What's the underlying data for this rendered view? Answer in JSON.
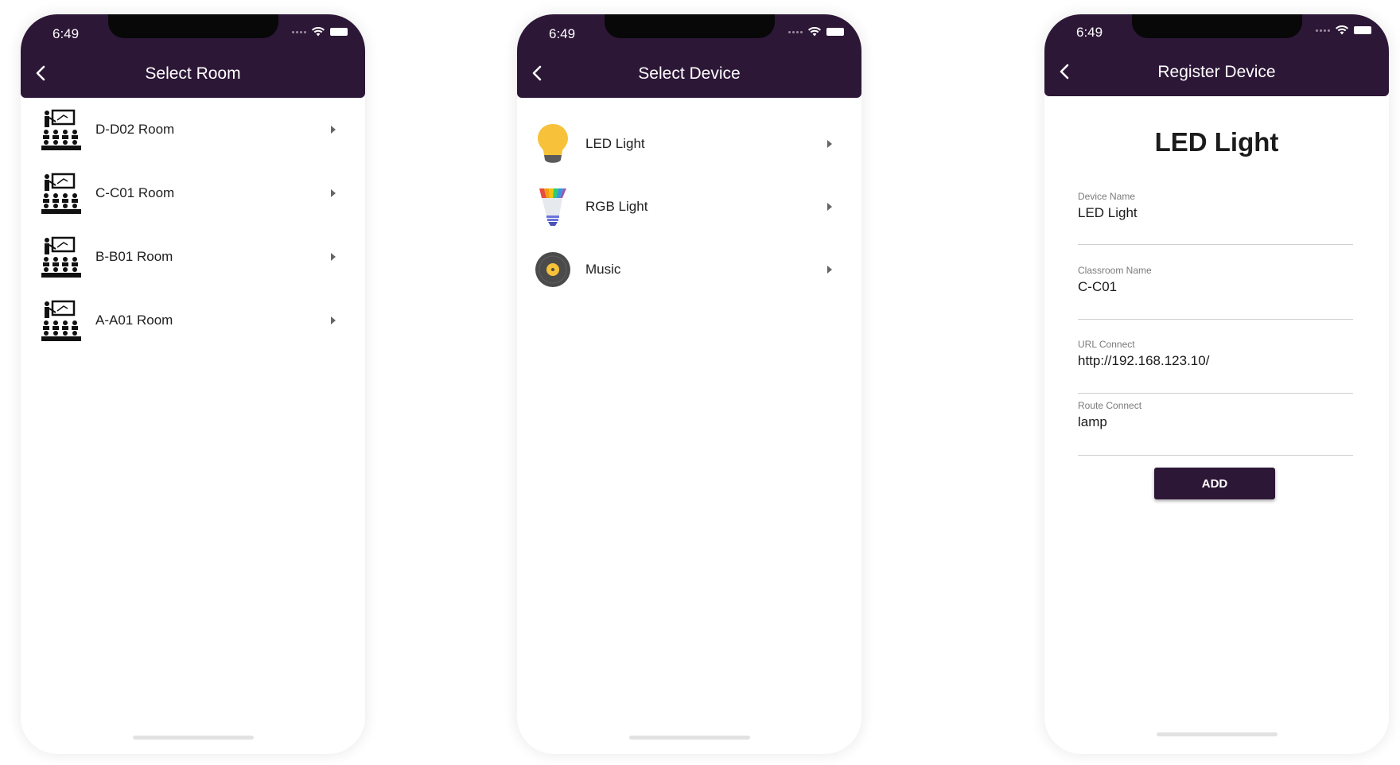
{
  "status_bar": {
    "time": "6:49"
  },
  "screens": {
    "select_room": {
      "title": "Select Room",
      "rooms": [
        {
          "label": "D-D02 Room"
        },
        {
          "label": "C-C01 Room"
        },
        {
          "label": "B-B01 Room"
        },
        {
          "label": "A-A01 Room"
        }
      ]
    },
    "select_device": {
      "title": "Select Device",
      "devices": [
        {
          "label": "LED Light",
          "icon": "bulb-icon"
        },
        {
          "label": "RGB Light",
          "icon": "rgb-bulb-icon"
        },
        {
          "label": "Music",
          "icon": "vinyl-disc-icon"
        }
      ]
    },
    "register_device": {
      "title": "Register Device",
      "heading": "LED Light",
      "fields": [
        {
          "label": "Device Name",
          "value": "LED Light"
        },
        {
          "label": "Classroom Name",
          "value": "C-C01"
        },
        {
          "label": "URL Connect",
          "value": "http://192.168.123.10/"
        },
        {
          "label": "Route Connect",
          "value": "lamp"
        }
      ],
      "add_button": "ADD"
    }
  },
  "colors": {
    "app_bar": "#2d1737",
    "button": "#2d1737"
  }
}
